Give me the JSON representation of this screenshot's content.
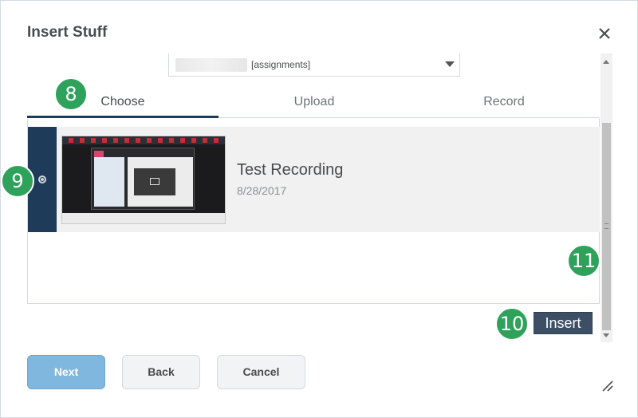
{
  "dialog": {
    "title": "Insert Stuff",
    "close_icon": "close-icon"
  },
  "source_select": {
    "value": "[assignments]",
    "caret_icon": "caret-down-icon"
  },
  "tabs": [
    {
      "label": "Choose",
      "active": true
    },
    {
      "label": "Upload",
      "active": false
    },
    {
      "label": "Record",
      "active": false
    }
  ],
  "items": [
    {
      "title": "Test Recording",
      "date": "8/28/2017",
      "selected": true
    }
  ],
  "insert_button": {
    "label": "Insert"
  },
  "footer": {
    "next_label": "Next",
    "back_label": "Back",
    "cancel_label": "Cancel"
  },
  "callouts": [
    "8",
    "9",
    "10",
    "11"
  ],
  "colors": {
    "primary_dark": "#1f3b5a",
    "insert_button": "#3c4f65",
    "next_button": "#7fb7de",
    "callout_green": "#2ea25b"
  }
}
